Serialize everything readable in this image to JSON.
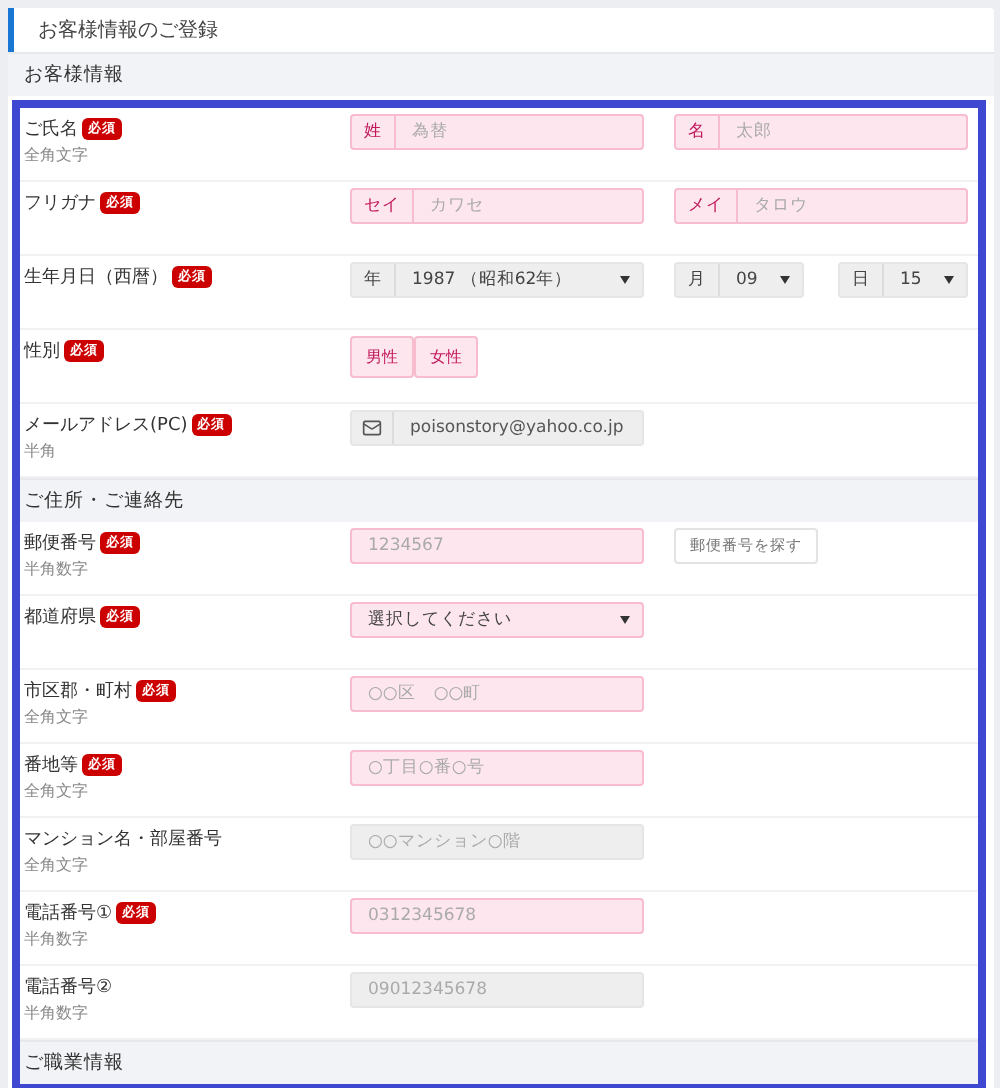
{
  "header": {
    "title": "お客様情報のご登録"
  },
  "sections": [
    {
      "title": "お客様情報",
      "rows": [
        {
          "label": "ご氏名",
          "badge": "必須",
          "note": "全角文字",
          "controls": [
            {
              "kind": "text",
              "required": true,
              "prefix": "姓",
              "placeholder": "為替"
            },
            {
              "kind": "text",
              "required": true,
              "prefix": "名",
              "placeholder": "太郎"
            }
          ]
        },
        {
          "label": "フリガナ",
          "badge": "必須",
          "controls": [
            {
              "kind": "text",
              "required": true,
              "prefix": "セイ",
              "placeholder": "カワセ"
            },
            {
              "kind": "text",
              "required": true,
              "prefix": "メイ",
              "placeholder": "タロウ"
            }
          ]
        },
        {
          "label": "生年月日（西暦）",
          "badge": "必須",
          "controls": [
            {
              "kind": "select",
              "required": false,
              "prefix": "年",
              "value": "1987 （昭和62年）"
            },
            {
              "kind": "select",
              "required": false,
              "prefix": "月",
              "value": "09"
            },
            {
              "kind": "select",
              "required": false,
              "prefix": "日",
              "value": "15"
            }
          ]
        },
        {
          "label": "性別",
          "badge": "必須",
          "controls": [
            {
              "kind": "choice",
              "options": [
                {
                  "label": "男性",
                  "selected": false
                },
                {
                  "label": "女性",
                  "selected": false
                }
              ]
            }
          ]
        },
        {
          "label": "メールアドレス(PC)",
          "badge": "必須",
          "note": "半角",
          "controls": [
            {
              "kind": "email",
              "required": false,
              "value": "poisonstory@yahoo.co.jp"
            }
          ]
        }
      ]
    },
    {
      "title": "ご住所・ご連絡先",
      "rows": [
        {
          "label": "郵便番号",
          "badge": "必須",
          "note": "半角数字",
          "controls": [
            {
              "kind": "text",
              "required": true,
              "placeholder": "1234567"
            },
            {
              "kind": "button",
              "label": "郵便番号を探す"
            }
          ]
        },
        {
          "label": "都道府県",
          "badge": "必須",
          "controls": [
            {
              "kind": "select",
              "required": true,
              "value": "選択してください"
            }
          ]
        },
        {
          "label": "市区郡・町村",
          "badge": "必須",
          "note": "全角文字",
          "controls": [
            {
              "kind": "text",
              "required": true,
              "placeholder": "○○区　○○町"
            }
          ]
        },
        {
          "label": "番地等",
          "badge": "必須",
          "note": "全角文字",
          "controls": [
            {
              "kind": "text",
              "required": true,
              "placeholder": "○丁目○番○号"
            }
          ]
        },
        {
          "label": "マンション名・部屋番号",
          "note": "全角文字",
          "controls": [
            {
              "kind": "text",
              "required": false,
              "placeholder": "○○マンション○階"
            }
          ]
        },
        {
          "label": "電話番号①",
          "badge": "必須",
          "note": "半角数字",
          "controls": [
            {
              "kind": "text",
              "required": true,
              "placeholder": "0312345678"
            }
          ]
        },
        {
          "label": "電話番号②",
          "note": "半角数字",
          "controls": [
            {
              "kind": "text",
              "required": false,
              "placeholder": "09012345678"
            }
          ]
        }
      ]
    },
    {
      "title": "ご職業情報"
    }
  ]
}
